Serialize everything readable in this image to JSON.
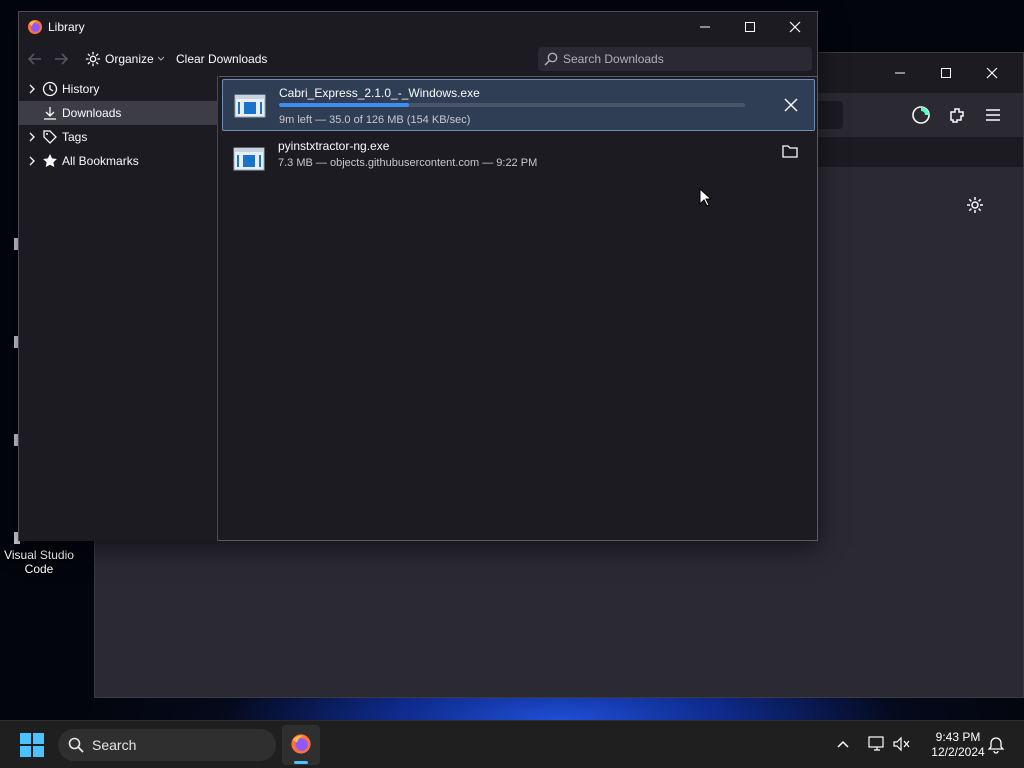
{
  "desktop": {
    "icons": [
      {
        "label_line1": "Visual Studio",
        "label_line2": "Code"
      }
    ]
  },
  "library": {
    "title": "Library",
    "toolbar": {
      "organize_label": "Organize",
      "clear_label": "Clear Downloads",
      "search_placeholder": "Search Downloads"
    },
    "sidebar": {
      "items": [
        {
          "label": "History"
        },
        {
          "label": "Downloads"
        },
        {
          "label": "Tags"
        },
        {
          "label": "All Bookmarks"
        }
      ]
    },
    "downloads": [
      {
        "name": "Cabri_Express_2.1.0_-_Windows.exe",
        "status": "9m left — 35.0 of 126 MB (154 KB/sec)",
        "progress": 0.278
      },
      {
        "name": "pyinstxtractor-ng.exe",
        "status": "7.3 MB — objects.githubusercontent.com — 9:22 PM"
      }
    ]
  },
  "taskbar": {
    "search_label": "Search",
    "time": "9:43 PM",
    "date": "12/2/2024"
  },
  "colors": {
    "accent": "#3c8ef0",
    "window_bg": "#1c1b22",
    "selected_row": "#2f3e55"
  }
}
